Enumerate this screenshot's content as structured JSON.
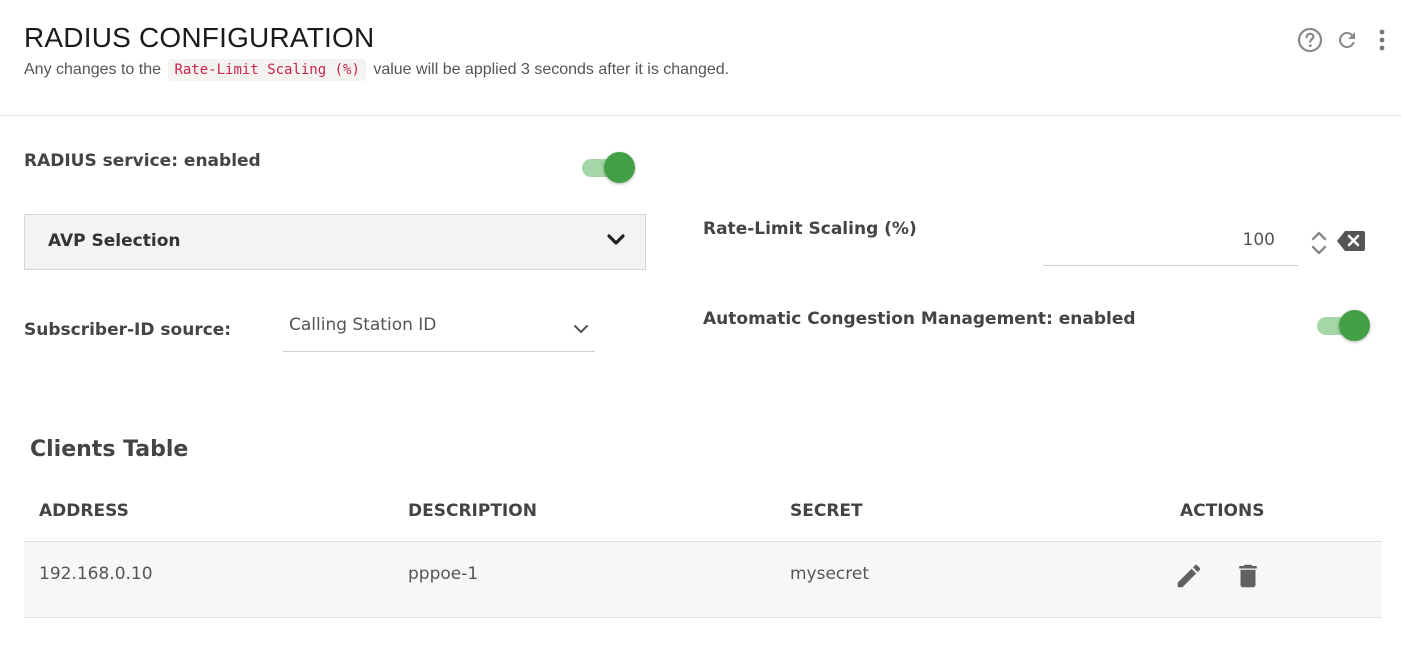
{
  "header": {
    "title": "RADIUS CONFIGURATION",
    "subtitle_before": "Any changes to the",
    "subtitle_code": "Rate-Limit Scaling (%)",
    "subtitle_after": "value will be applied 3 seconds after it is changed.",
    "icons": [
      "help-icon",
      "refresh-icon",
      "more-vert-icon"
    ]
  },
  "radius_service": {
    "label": "RADIUS service: enabled",
    "enabled": true
  },
  "avp_selection": {
    "label": "AVP Selection",
    "icon": "chevron-down-icon"
  },
  "subscriber_id": {
    "label": "Subscriber-ID source:",
    "selected": "Calling Station ID"
  },
  "rate_limit": {
    "label": "Rate-Limit Scaling (%)",
    "value": "100"
  },
  "congestion": {
    "label": "Automatic Congestion Management: enabled",
    "enabled": true
  },
  "clients_table": {
    "title": "Clients Table",
    "columns": [
      "ADDRESS",
      "DESCRIPTION",
      "SECRET",
      "ACTIONS"
    ],
    "rows": [
      {
        "address": "192.168.0.10",
        "description": "pppoe-1",
        "secret": "mysecret"
      }
    ],
    "action_icons": [
      "edit-icon",
      "delete-icon"
    ]
  },
  "colors": {
    "toggle_on": "#43a047",
    "toggle_track": "#a5d6a7",
    "code_text": "#c7254e",
    "icon_gray": "#616161"
  }
}
